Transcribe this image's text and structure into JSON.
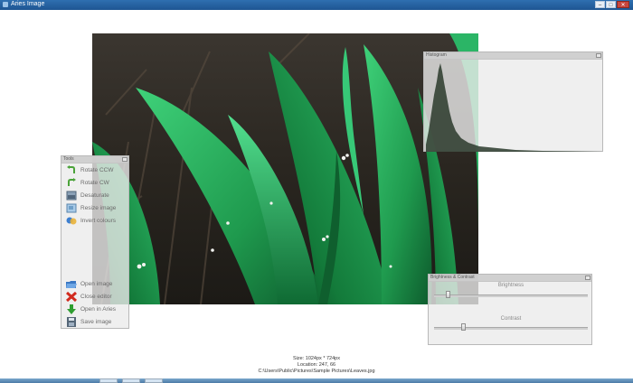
{
  "window": {
    "title": "Aries Image",
    "icon": "app-icon",
    "controls": [
      "minimize-icon",
      "maximize-icon",
      "close-icon"
    ]
  },
  "tools_panel": {
    "title": "Tools",
    "items": [
      {
        "label": "Rotate CCW",
        "icon": "rotate-ccw-icon",
        "color": "#4ba33a"
      },
      {
        "label": "Rotate CW",
        "icon": "rotate-cw-icon",
        "color": "#4ba33a"
      },
      {
        "label": "Desaturate",
        "icon": "desaturate-icon",
        "color": "#6e8aa8"
      },
      {
        "label": "Resize image",
        "icon": "resize-icon",
        "color": "#6f9fc8"
      },
      {
        "label": "Invert colours",
        "icon": "invert-colours-icon",
        "color": "#3d7fd0"
      },
      {
        "label": "Open image",
        "icon": "folder-open-icon",
        "color": "#3b78c4"
      },
      {
        "label": "Close editor",
        "icon": "close-x-icon",
        "color": "#d12a1e"
      },
      {
        "label": "Open in Aries",
        "icon": "arrow-down-green-icon",
        "color": "#2f9e31"
      },
      {
        "label": "Save image",
        "icon": "floppy-disk-icon",
        "color": "#556677"
      }
    ]
  },
  "histogram_panel": {
    "title": "Histogram"
  },
  "brightness_contrast_panel": {
    "title": "Brightness & Contrast",
    "brightness_label": "Brightness",
    "contrast_label": "Contrast",
    "brightness_level": 0.08,
    "contrast_level": 0.18
  },
  "image_info": {
    "size": "Size: 1024px * 724px",
    "location": "Location: 247, 66",
    "path": "C:\\Users\\Public\\Pictures\\Sample Pictures\\Leaves.jpg"
  }
}
